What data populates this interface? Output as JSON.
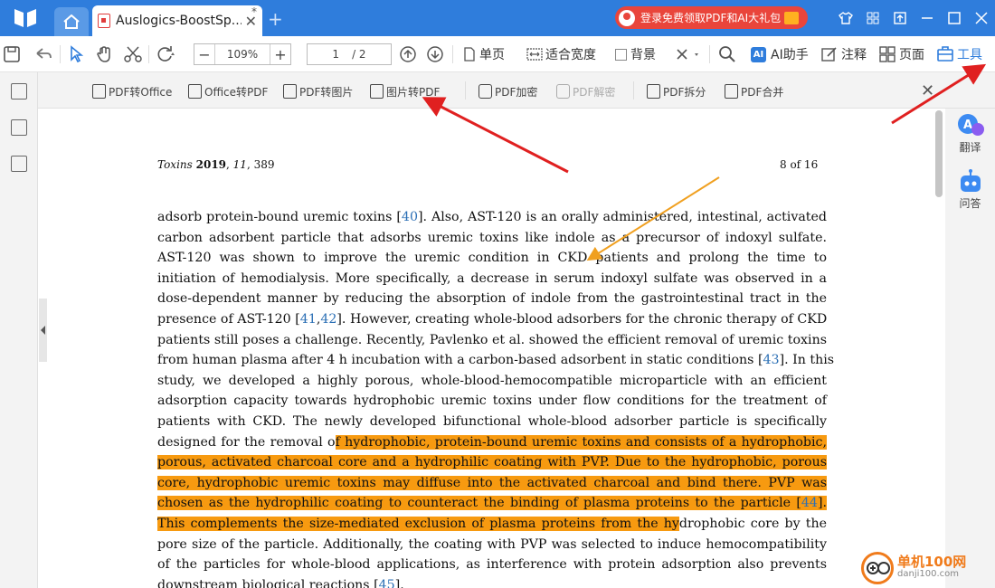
{
  "titlebar": {
    "tab_title": "Auslogics-BoostSp...",
    "tab_modified": "*",
    "tab_close": "✕",
    "new_tab": "+",
    "promo_text": "登录免费领取PDF和AI大礼包"
  },
  "toolbar": {
    "zoom": "109%",
    "zoom_minus": "−",
    "zoom_plus": "+",
    "page_current": "1",
    "page_total": "/ 2",
    "single_page": "单页",
    "fit_width": "适合宽度",
    "background": "背景",
    "ai_label": "AI助手",
    "annotate": "注释",
    "page": "页面",
    "tools": "工具"
  },
  "subbar": {
    "items": [
      {
        "label": "PDF转Office",
        "enabled": true
      },
      {
        "label": "Office转PDF",
        "enabled": true
      },
      {
        "label": "PDF转图片",
        "enabled": true
      },
      {
        "label": "图片转PDF",
        "enabled": true
      },
      {
        "label": "PDF加密",
        "enabled": true
      },
      {
        "label": "PDF解密",
        "enabled": false
      },
      {
        "label": "PDF拆分",
        "enabled": true
      },
      {
        "label": "PDF合并",
        "enabled": true
      }
    ]
  },
  "rightbar": {
    "translate": "翻译",
    "ask": "问答"
  },
  "document": {
    "journal": "Toxins",
    "year": "2019",
    "volume": "11",
    "pages": "389",
    "page_label": "8 of 16",
    "cite_40": "40",
    "cite_41": "41",
    "cite_42": "42",
    "cite_43": "43",
    "cite_44": "44",
    "cite_45": "45"
  },
  "watermark": {
    "name": "单机100网",
    "url": "danji100.com"
  },
  "colors": {
    "accent": "#2f7ddc",
    "highlight": "#f79a10",
    "promo": "#e9453b",
    "arrow_red": "#e02020",
    "arrow_orange": "#f0a020"
  }
}
